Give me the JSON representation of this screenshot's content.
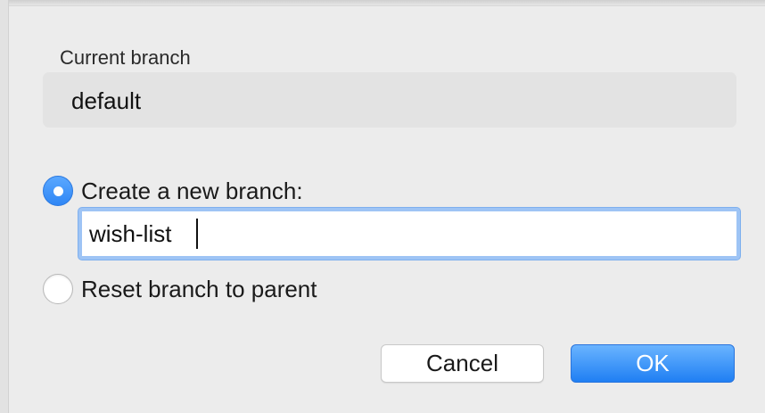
{
  "current_branch": {
    "label": "Current branch",
    "value": "default"
  },
  "options": {
    "create_new": {
      "label": "Create a new branch:",
      "selected": true,
      "input_value": "wish-list"
    },
    "reset_to_parent": {
      "label": "Reset branch to parent",
      "selected": false
    }
  },
  "buttons": {
    "cancel_label": "Cancel",
    "ok_label": "OK"
  },
  "colors": {
    "accent": "#2f86f5",
    "focus_ring": "#9ec4f5",
    "background": "#ececec"
  }
}
